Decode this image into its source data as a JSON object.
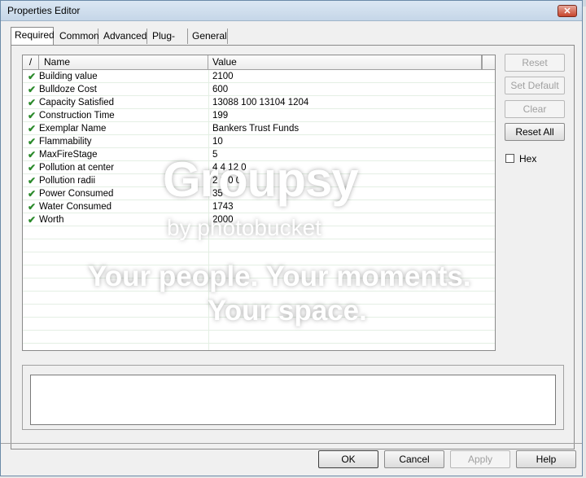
{
  "window": {
    "title": "Properties Editor",
    "close_glyph": "✕"
  },
  "tabs": [
    {
      "label": "Required",
      "active": true
    },
    {
      "label": "Common"
    },
    {
      "label": "Advanced"
    },
    {
      "label": "Plug-ins"
    },
    {
      "label": "General"
    }
  ],
  "grid": {
    "sort_glyph": "/",
    "col_name": "Name",
    "col_value": "Value",
    "rows": [
      {
        "name": "Building value",
        "value": "2100"
      },
      {
        "name": "Bulldoze Cost",
        "value": "600"
      },
      {
        "name": "Capacity Satisfied",
        "value": "13088 100 13104 1204"
      },
      {
        "name": "Construction Time",
        "value": "199"
      },
      {
        "name": "Exemplar Name",
        "value": "Bankers Trust Funds"
      },
      {
        "name": "Flammability",
        "value": "10"
      },
      {
        "name": "MaxFireStage",
        "value": "5"
      },
      {
        "name": "Pollution at center",
        "value": "4 4 12 0"
      },
      {
        "name": "Pollution radii",
        "value": "2 3 0 0"
      },
      {
        "name": "Power Consumed",
        "value": "35"
      },
      {
        "name": "Water Consumed",
        "value": "1743"
      },
      {
        "name": "Worth",
        "value": "2000"
      }
    ],
    "check_glyph": "✔"
  },
  "side_buttons": {
    "reset": "Reset",
    "set_default": "Set Default",
    "clear": "Clear",
    "reset_all": "Reset All"
  },
  "hex": {
    "label": "Hex",
    "checked": false
  },
  "bottom_buttons": {
    "ok": "OK",
    "cancel": "Cancel",
    "apply": "Apply",
    "help": "Help"
  },
  "watermark": {
    "brand": "Groupsy",
    "byline": "by photobucket",
    "line1": "Your people. Your moments.",
    "line2": "Your space."
  },
  "colors": {
    "check": "#2b8a2b",
    "title_gradient_top": "#dbe7f3",
    "close": "#c7442c"
  }
}
